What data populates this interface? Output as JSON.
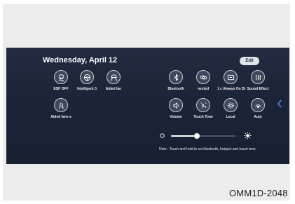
{
  "screen": {
    "date": "Wednesday, April 12",
    "edit_label": "Edit",
    "left_tiles": [
      {
        "label": "ESP OFF",
        "icon": "car-skid-icon"
      },
      {
        "label": "Intelligent 3",
        "icon": "steering-wheel-icon"
      },
      {
        "label": "Aided lan",
        "icon": "lane-assist-icon"
      },
      {
        "label": "Aided lane a",
        "icon": "lane-hand-icon"
      }
    ],
    "right_tiles": [
      {
        "label": "Bluetooth",
        "icon": "bluetooth-icon"
      },
      {
        "label": "nected",
        "icon": "link-icon"
      },
      {
        "label": "1 c Always On Di",
        "icon": "display-icon"
      },
      {
        "label": "Sound Effect",
        "icon": "equalizer-icon"
      },
      {
        "label": "Volume",
        "icon": "speaker-icon"
      },
      {
        "label": "Touch Tone",
        "icon": "touch-tone-icon"
      },
      {
        "label": "Local",
        "icon": "gear-icon"
      },
      {
        "label": "Auto",
        "icon": "auto-icon"
      }
    ],
    "brightness_level_percent": 40,
    "note": "Note : Touch and hold to set bluetooth, hotspot and touch tone"
  },
  "caption": "OMM1D-2048",
  "colors": {
    "screen_bg": "#1b2337",
    "circle_bg": "#3e475d",
    "accent_blue": "#5a84d8"
  }
}
